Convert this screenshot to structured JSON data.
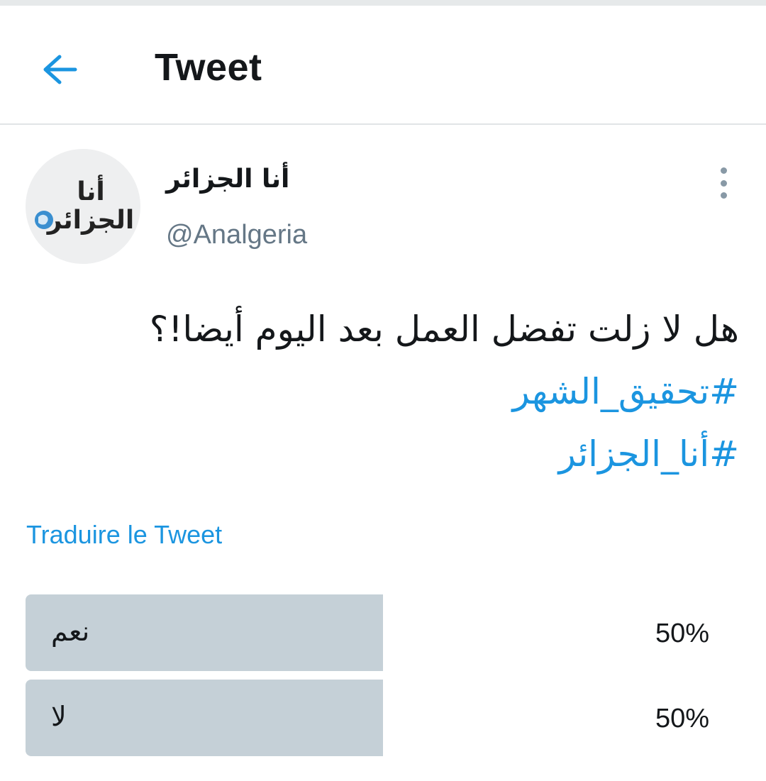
{
  "header": {
    "title": "Tweet",
    "back_icon": "arrow-left-icon"
  },
  "colors": {
    "accent": "#1b95e0",
    "muted": "#657786",
    "poll_bar": "#c5d0d7"
  },
  "tweet": {
    "author": {
      "name": "أنا الجزائر",
      "handle": "@Analgeria"
    },
    "text_lines": [
      "هل لا زلت تفضل العمل بعد اليوم أيضا!؟"
    ],
    "hashtags": [
      "#تحقيق_الشهر",
      "#أنا_الجزائر"
    ],
    "translate_label": "Traduire le Tweet"
  },
  "poll": {
    "options": [
      {
        "label": "نعم",
        "percent_text": "50%",
        "percent": 50
      },
      {
        "label": "لا",
        "percent_text": "50%",
        "percent": 50
      }
    ]
  }
}
